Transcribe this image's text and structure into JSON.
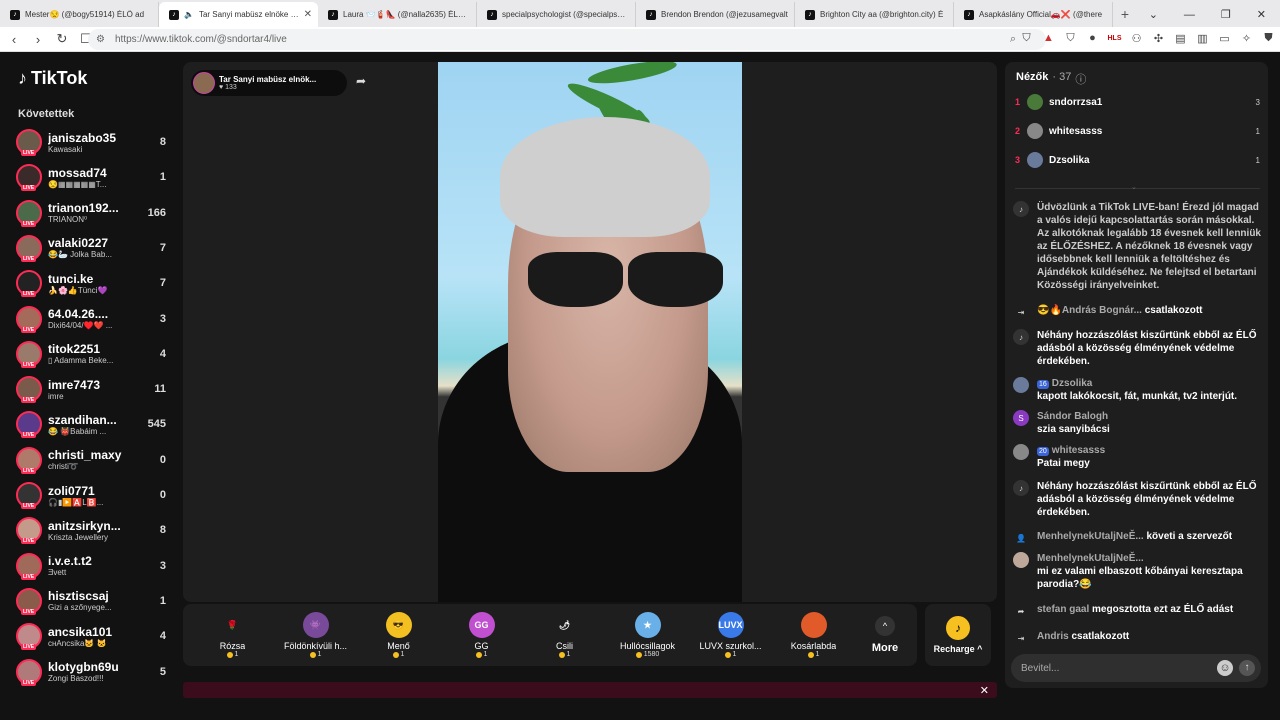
{
  "browser": {
    "tabs": [
      {
        "title": "Mester😒 (@bogy51914) ÉLŐ ad"
      },
      {
        "title": "Tar Sanyi mabüsz elnöke Be"
      },
      {
        "title": "Laura 📨🧯👠 (@nalla2635) ÉLŐ a"
      },
      {
        "title": "specialpsychologist (@specialpsych"
      },
      {
        "title": "Brendon Brendon (@jezusamegvalt"
      },
      {
        "title": "Brighton City aa (@brighton.city) É"
      },
      {
        "title": "Asapkáslány Official🚗❌ (@there"
      }
    ],
    "new_tab": "+",
    "url": "https://www.tiktok.com/@sndortar4/live"
  },
  "tiktok": {
    "logo": "TikTok",
    "following_header": "Követettek",
    "accounts": [
      {
        "name": "janiszabo35",
        "sub": "Kawasaki",
        "count": "8",
        "color": "#6a5a4a"
      },
      {
        "name": "mossad74",
        "sub": "😒▦▦▦▦▦T...",
        "count": "1",
        "color": "#3a2a2a"
      },
      {
        "name": "trianon192...",
        "sub": "TRIANON⁰",
        "count": "166",
        "color": "#4a6a4a"
      },
      {
        "name": "valaki0227",
        "sub": "😂🦢 Jolka Bab...",
        "count": "7",
        "color": "#8a6a5a"
      },
      {
        "name": "tunci.ke",
        "sub": "🍌🌸👍Tünci💜",
        "count": "7",
        "color": "#222"
      },
      {
        "name": "64.04.26....",
        "sub": "Dixi64/04/♥️❤️ ...",
        "count": "3",
        "color": "#a46a5a"
      },
      {
        "name": "titok2251",
        "sub": "▯ Adamma Beke...",
        "count": "4",
        "color": "#9a7a6a"
      },
      {
        "name": "imre7473",
        "sub": "imre",
        "count": "11",
        "color": "#7a5a4a"
      },
      {
        "name": "szandihan...",
        "sub": "😂 👹Babáim ...",
        "count": "545",
        "color": "#5a3a8a"
      },
      {
        "name": "christi_maxy",
        "sub": "christi➰",
        "count": "0",
        "color": "#b07a6a"
      },
      {
        "name": "zoli0771",
        "sub": "🎧▮▶️🅰️L🅱️...",
        "count": "0",
        "color": "#333"
      },
      {
        "name": "anitzsirkyn...",
        "sub": "Kriszta Jewellery",
        "count": "8",
        "color": "#c49a8a"
      },
      {
        "name": "i.v.e.t.t2",
        "sub": "Ǝvett",
        "count": "3",
        "color": "#a06a5a"
      },
      {
        "name": "hisztiscsaj",
        "sub": "Gizi a szőnyege...",
        "count": "1",
        "color": "#8a5a4a"
      },
      {
        "name": "ancsika101",
        "sub": "снAncsika🐱 🐱",
        "count": "4",
        "color": "#c08a8a"
      },
      {
        "name": "klotygbn69u",
        "sub": "Zongi Baszod!!!",
        "count": "5",
        "color": "#b07a7a"
      }
    ],
    "live_tag": "LIVE"
  },
  "stream": {
    "title": "Tar Sanyi mabüsz elnök...",
    "likes": "♥ 133"
  },
  "gifts": [
    {
      "name": "Rózsa",
      "price": "1",
      "icon": "🌹",
      "bg": "#1e1e1e"
    },
    {
      "name": "Földönkívüli h...",
      "price": "1",
      "icon": "👾",
      "bg": "#7a4a9a"
    },
    {
      "name": "Menő",
      "price": "1",
      "icon": "😎",
      "bg": "#f3c021"
    },
    {
      "name": "GG",
      "price": "1",
      "icon": "GG",
      "bg": "#c050d0"
    },
    {
      "name": "Csili",
      "price": "1",
      "icon": "🌶",
      "bg": "#1e1e1e"
    },
    {
      "name": "Hullócsillagok",
      "price": "1580",
      "icon": "★",
      "bg": "#6ab0e8"
    },
    {
      "name": "LUVX szurkol...",
      "price": "1",
      "icon": "LUVX",
      "bg": "#3a7ae8"
    },
    {
      "name": "Kosárlabda",
      "price": "1",
      "icon": "",
      "bg": "#e05a2a"
    }
  ],
  "more": {
    "label": "More",
    "icon": "^"
  },
  "recharge": {
    "label": "Recharge ^",
    "icon": "♪"
  },
  "viewers": {
    "header": "Nézők",
    "count": "· 37",
    "list": [
      {
        "rank": "1",
        "name": "sndorrzsa1",
        "score": "3",
        "color": "#4a7a3a"
      },
      {
        "rank": "2",
        "name": "whitesasss",
        "score": "1",
        "color": "#888"
      },
      {
        "rank": "3",
        "name": "Dzsolika",
        "score": "1",
        "color": "#6a7a9a"
      }
    ]
  },
  "chat": {
    "welcome": "Üdvözlünk a TikTok LIVE-ban! Érezd jól magad a valós idejű kapcsolattartás során másokkal. Az alkotóknak legalább 18 évesnek kell lenniük az ÉLŐZÉSHEZ. A nézőknek 18 évesnek vagy idősebbnek kell lenniük a feltöltéshez és Ajándékok küldéséhez. Ne felejtsd el betartani Közösségi irányelveinket.",
    "m1_name": "😎🔥András Bognár...",
    "m1_action": "csatlakozott",
    "filter1": "Néhány hozzászólást kiszűrtünk ebből az ÉLŐ adásból a közösség élményének védelme érdekében.",
    "m2_badge": "16",
    "m2_name": "Dzsolika",
    "m2_text": "kapott lakókocsit, fát, munkát, tv2 interjút.",
    "m3_initial": "S",
    "m3_name": "Sándor Balogh",
    "m3_text": "szia sanyibácsi",
    "m4_badge": "20",
    "m4_name": "whitesasss",
    "m4_text": "Patai megy",
    "filter2": "Néhány hozzászólást kiszűrtünk ebből az ÉLŐ adásból a közösség élményének védelme érdekében.",
    "m5_name": "MenhelynekUtaljNeĚ...",
    "m5_action": "követi a szervezőt",
    "m6_name": "MenhelynekUtaljNeĚ...",
    "m6_text": "mi ez valami elbaszott kőbányai keresztapa parodia?😂",
    "m7_name": "stefan gaal",
    "m7_action": "megosztotta ezt az ÉLŐ adást",
    "m8_name": "Andris",
    "m8_action": "csatlakozott",
    "input_placeholder": "Bevitel..."
  }
}
